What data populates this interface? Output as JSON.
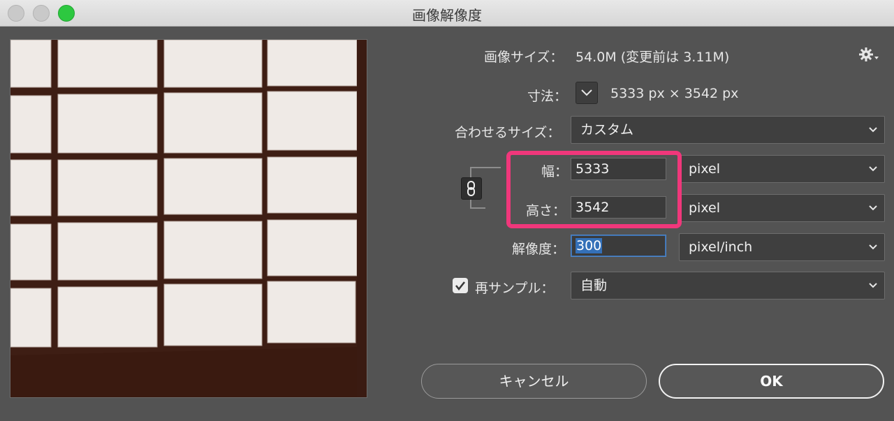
{
  "window": {
    "title": "画像解像度"
  },
  "info": {
    "image_size_label": "画像サイズ：",
    "image_size_value": "54.0M (変更前は 3.11M)",
    "dimensions_label": "寸法：",
    "dimensions_value": "5333 px × 3542 px"
  },
  "fit_to": {
    "label": "合わせるサイズ：",
    "value": "カスタム"
  },
  "width": {
    "label": "幅：",
    "value": "5333",
    "unit": "pixel"
  },
  "height": {
    "label": "高さ：",
    "value": "3542",
    "unit": "pixel"
  },
  "resolution": {
    "label": "解像度：",
    "value": "300",
    "unit": "pixel/inch"
  },
  "resample": {
    "label": "再サンプル：",
    "checked": true,
    "value": "自動"
  },
  "buttons": {
    "cancel": "キャンセル",
    "ok": "OK"
  },
  "colors": {
    "highlight": "#f0377b",
    "focus": "#3470b8",
    "window_bg": "#535353"
  },
  "icons": [
    "gear-icon",
    "chevron-down-icon",
    "link-icon",
    "checkmark-icon"
  ]
}
